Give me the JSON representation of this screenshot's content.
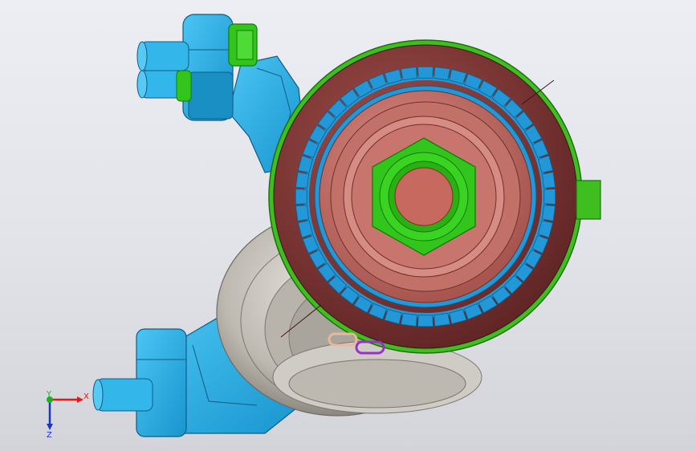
{
  "viewport": {
    "background_top": "#eceef3",
    "background_bottom": "#d3d4da"
  },
  "model": {
    "colors": {
      "bracket": "#2aaee6",
      "bracket_dark": "#137fb3",
      "pulley": "#c7c3bb",
      "pulley_dark": "#8f8b84",
      "housing": "#7a3535",
      "housing_light": "#b36a62",
      "hub": "#c96b62",
      "tone_ring": "#2298d8",
      "seal": "#3fbf1f",
      "nut": "#32c51b",
      "clip_a": "#e8b89a",
      "clip_b": "#9b30c8"
    },
    "tone_ring_teeth": 48
  },
  "triad": {
    "x_label": "X",
    "y_label": "Y",
    "z_label": "Z",
    "x_color": "#e11b1b",
    "y_color": "#18b418",
    "z_color": "#1a34c8"
  }
}
